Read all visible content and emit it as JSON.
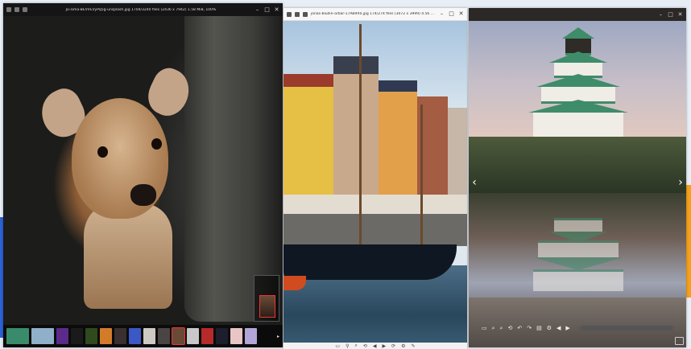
{
  "windows": [
    {
      "title": "Jo-sima-BEVVEVyPq5g-unsplash.jpg 1704/3240 files (2436 x 7942) 1.58 MiB, 100%",
      "controls": [
        "–",
        "□",
        "✕"
      ],
      "thumbnails": [
        {
          "icon": "thumb-flowers",
          "color": "#3a8b6b"
        },
        {
          "icon": "thumb-water",
          "color": "#8fb0c8"
        },
        {
          "icon": "thumb-purple",
          "color": "#5b2b8c"
        },
        {
          "icon": "thumb-dark",
          "color": "#1a1a1a"
        },
        {
          "icon": "thumb-forest",
          "color": "#2f4a1d"
        },
        {
          "icon": "thumb-sunset",
          "color": "#d47b2a"
        },
        {
          "icon": "thumb-mountain",
          "color": "#3a3030"
        },
        {
          "icon": "thumb-blue",
          "color": "#3c58c7"
        },
        {
          "icon": "thumb-portrait",
          "color": "#cfc9c3"
        },
        {
          "icon": "thumb-city",
          "color": "#4a4545"
        },
        {
          "icon": "thumb-deer",
          "color": "#6a4a35"
        },
        {
          "icon": "thumb-bird",
          "color": "#c8c8c8"
        },
        {
          "icon": "thumb-red",
          "color": "#b52a2a"
        },
        {
          "icon": "thumb-night",
          "color": "#1d1d2d"
        },
        {
          "icon": "thumb-pink",
          "color": "#e9c5c5"
        },
        {
          "icon": "thumb-lilac",
          "color": "#b2a6d8"
        }
      ],
      "active_thumb": 10
    },
    {
      "title": "jonas-bludin-orbar-17AB9X0.jpg 174/274 files (3072 x 3999) 4.56 MiB",
      "controls": [
        "–",
        "□",
        "✕"
      ],
      "toolbar": [
        "▭",
        "⚲",
        "⌕",
        "⟲",
        "◀",
        "▶",
        "⟳",
        "⚙",
        "✎"
      ]
    },
    {
      "title": "",
      "controls": [
        "–",
        "□",
        "✕"
      ],
      "toolbar": [
        "▭",
        "⌕",
        "⌕",
        "⟲",
        "↶",
        "↷",
        "▤",
        "⚙",
        "◀",
        "▶"
      ],
      "zoom_fraction": 0.0
    }
  ],
  "colors": {
    "accent_blue": "#2b62d9",
    "accent_orange": "#f4a11c",
    "active_thumb_border": "#e33333"
  }
}
